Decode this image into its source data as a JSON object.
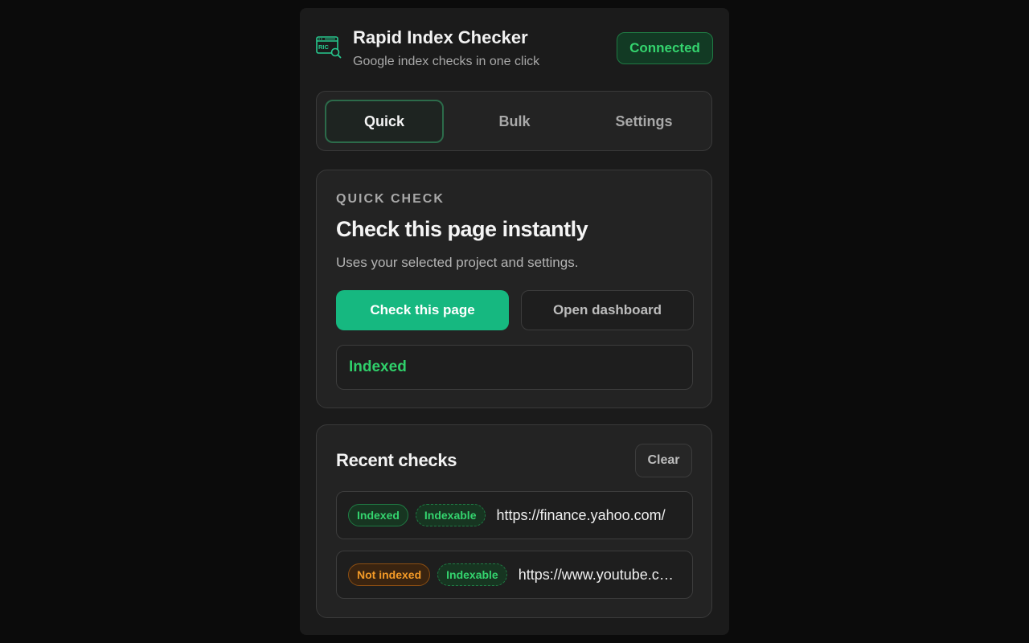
{
  "header": {
    "title": "Rapid Index Checker",
    "subtitle": "Google index checks in one click",
    "status": "Connected",
    "logo_text": "RIC"
  },
  "tabs": [
    {
      "label": "Quick",
      "active": true
    },
    {
      "label": "Bulk",
      "active": false
    },
    {
      "label": "Settings",
      "active": false
    }
  ],
  "quick_check": {
    "eyebrow": "QUICK CHECK",
    "title": "Check this page instantly",
    "description": "Uses your selected project and settings.",
    "primary_button": "Check this page",
    "secondary_button": "Open dashboard",
    "result": "Indexed"
  },
  "recent": {
    "title": "Recent checks",
    "clear_label": "Clear",
    "items": [
      {
        "status": "Indexed",
        "indexability": "Indexable",
        "url": "https://finance.yahoo.com/"
      },
      {
        "status": "Not indexed",
        "indexability": "Indexable",
        "url": "https://www.youtube.com/"
      }
    ]
  },
  "colors": {
    "accent": "#16b880",
    "success": "#34d46e",
    "warning": "#f39a27",
    "background": "#1b1b1b"
  }
}
